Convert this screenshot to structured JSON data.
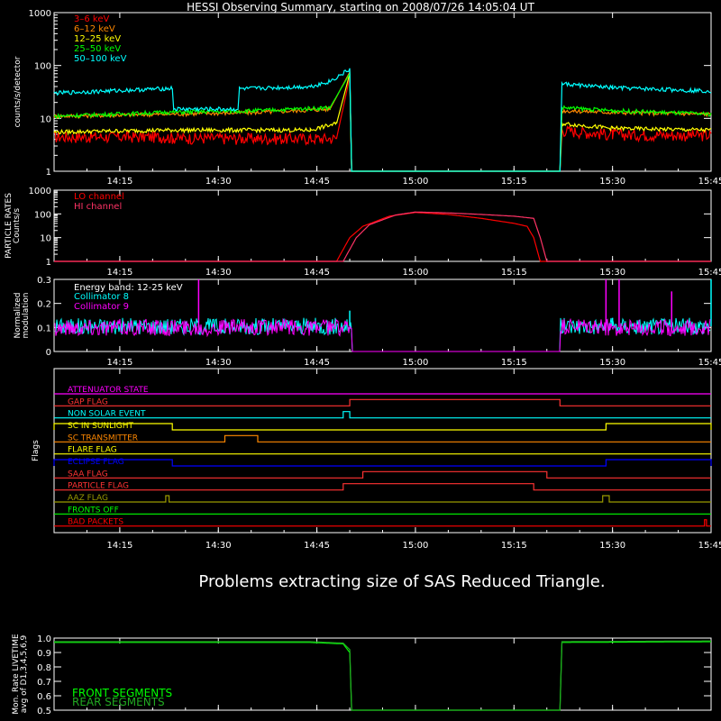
{
  "title": "HESSI Observing Summary, starting on 2008/07/26 14:05:04 UT",
  "message": "Problems extracting size of SAS Reduced Triangle.",
  "time_axis": {
    "start": "14:05",
    "end": "15:45",
    "tick_labels": [
      "14:15",
      "14:30",
      "14:45",
      "15:00",
      "15:15",
      "15:30",
      "15:45"
    ]
  },
  "chart_data": [
    {
      "type": "line",
      "name": "count_rates",
      "ylabel": "counts/s/detector",
      "yscale": "log",
      "ylim": [
        1,
        1000
      ],
      "ytick_labels": [
        "1",
        "10",
        "100",
        "1000"
      ],
      "legend_position": "top-left",
      "series": [
        {
          "name": "3–6 keV",
          "color": "#ff0000",
          "points": [
            [
              "14:05",
              4.5
            ],
            [
              "14:22",
              4.5
            ],
            [
              "14:23",
              4.3
            ],
            [
              "14:36",
              4.2
            ],
            [
              "14:44",
              4.2
            ],
            [
              "14:48",
              4.2
            ],
            [
              "14:50",
              60
            ],
            [
              "14:50.3",
              1
            ],
            [
              "15:22",
              1
            ],
            [
              "15:22.3",
              6
            ],
            [
              "15:30",
              5
            ],
            [
              "15:45",
              4.8
            ]
          ]
        },
        {
          "name": "6–12 keV",
          "color": "#ff8800",
          "points": [
            [
              "14:05",
              11
            ],
            [
              "14:22",
              12
            ],
            [
              "14:36",
              13
            ],
            [
              "14:47",
              15
            ],
            [
              "14:50",
              75
            ],
            [
              "14:50.3",
              1
            ],
            [
              "15:22",
              1
            ],
            [
              "15:22.3",
              14
            ],
            [
              "15:30",
              13
            ],
            [
              "15:45",
              12
            ]
          ]
        },
        {
          "name": "12–25 keV",
          "color": "#ffff00",
          "points": [
            [
              "14:05",
              5.5
            ],
            [
              "14:22",
              6
            ],
            [
              "14:36",
              6
            ],
            [
              "14:44",
              6
            ],
            [
              "14:48",
              8
            ],
            [
              "14:50",
              70
            ],
            [
              "14:50.3",
              1
            ],
            [
              "15:22",
              1
            ],
            [
              "15:22.3",
              8
            ],
            [
              "15:30",
              6.5
            ],
            [
              "15:45",
              6
            ]
          ]
        },
        {
          "name": "25–50 keV",
          "color": "#00ff00",
          "points": [
            [
              "14:05",
              11
            ],
            [
              "14:22",
              13
            ],
            [
              "14:36",
              14
            ],
            [
              "14:47",
              16
            ],
            [
              "14:50",
              70
            ],
            [
              "14:50.3",
              1
            ],
            [
              "15:22",
              1
            ],
            [
              "15:22.3",
              16
            ],
            [
              "15:30",
              14
            ],
            [
              "15:45",
              12
            ]
          ]
        },
        {
          "name": "50–100 keV",
          "color": "#00ffff",
          "points": [
            [
              "14:05",
              30
            ],
            [
              "14:23",
              37
            ],
            [
              "14:23.2",
              15
            ],
            [
              "14:33",
              15
            ],
            [
              "14:33.2",
              36
            ],
            [
              "14:44",
              40
            ],
            [
              "14:47",
              50
            ],
            [
              "14:50",
              85
            ],
            [
              "14:50.3",
              1
            ],
            [
              "15:22",
              1
            ],
            [
              "15:22.3",
              45
            ],
            [
              "15:30",
              38
            ],
            [
              "15:45",
              33
            ]
          ]
        }
      ]
    },
    {
      "type": "line",
      "name": "particle_rates",
      "ylabel": "PARTICLE RATES Counts/s",
      "yscale": "log",
      "ylim": [
        1,
        1000
      ],
      "ytick_labels": [
        "1",
        "10",
        "100",
        "1000"
      ],
      "legend_position": "top-left",
      "series": [
        {
          "name": "LO channel",
          "color": "#ff0000",
          "points": [
            [
              "14:05",
              1
            ],
            [
              "14:48",
              1
            ],
            [
              "14:50",
              10
            ],
            [
              "14:52",
              30
            ],
            [
              "14:56",
              80
            ],
            [
              "15:00",
              115
            ],
            [
              "15:05",
              95
            ],
            [
              "15:10",
              65
            ],
            [
              "15:15",
              40
            ],
            [
              "15:17",
              30
            ],
            [
              "15:18",
              10
            ],
            [
              "15:19",
              1
            ],
            [
              "15:45",
              1
            ]
          ]
        },
        {
          "name": "HI channel",
          "color": "#ff3366",
          "points": [
            [
              "14:05",
              1
            ],
            [
              "14:49",
              1
            ],
            [
              "14:51",
              10
            ],
            [
              "14:53",
              35
            ],
            [
              "14:57",
              90
            ],
            [
              "15:00",
              120
            ],
            [
              "15:05",
              110
            ],
            [
              "15:10",
              95
            ],
            [
              "15:15",
              80
            ],
            [
              "15:18",
              65
            ],
            [
              "15:19",
              10
            ],
            [
              "15:20",
              1
            ],
            [
              "15:45",
              1
            ]
          ]
        }
      ]
    },
    {
      "type": "line",
      "name": "modulation",
      "ylabel": "Normalized modulation",
      "ylim": [
        0,
        0.3
      ],
      "ytick_labels": [
        "0",
        "0.1",
        "0.2",
        "0.3"
      ],
      "annotation": "Energy band: 12-25 keV",
      "legend_position": "top-left",
      "series": [
        {
          "name": "Collimator 8",
          "color": "#00ffff",
          "mean": 0.105,
          "spikes": [
            [
              "14:50",
              0.17
            ],
            [
              "15:30",
              0.14
            ],
            [
              "15:45",
              0.3
            ]
          ]
        },
        {
          "name": "Collimator 9",
          "color": "#ff00ff",
          "mean": 0.1,
          "spikes": [
            [
              "14:27",
              0.3
            ],
            [
              "15:29",
              0.3
            ],
            [
              "15:31",
              0.3
            ],
            [
              "15:39",
              0.25
            ]
          ]
        }
      ],
      "data_gaps": [
        [
          "14:50.3",
          "15:22"
        ]
      ]
    },
    {
      "type": "line",
      "name": "flags",
      "ylabel": "Flags",
      "flags": [
        {
          "name": "ATTENUATOR STATE",
          "color": "#ff00ff",
          "intervals": []
        },
        {
          "name": "GAP FLAG",
          "color": "#ff3333",
          "intervals": [
            [
              "14:50",
              "15:22"
            ]
          ]
        },
        {
          "name": "NON SOLAR EVENT",
          "color": "#00ffff",
          "intervals": [
            [
              "14:49",
              "14:50"
            ]
          ]
        },
        {
          "name": "SC IN SUNLIGHT",
          "color": "#ffff00",
          "intervals": [
            [
              "14:05",
              "14:23"
            ],
            [
              "15:29",
              "15:45"
            ]
          ],
          "inverted": true
        },
        {
          "name": "SC TRANSMITTER",
          "color": "#ff8800",
          "intervals": [
            [
              "14:31",
              "14:36"
            ]
          ]
        },
        {
          "name": "FLARE FLAG",
          "color": "#ffff00",
          "intervals": []
        },
        {
          "name": "ECLIPSE FLAG",
          "color": "#0000ff",
          "intervals": [
            [
              "14:05",
              "14:23"
            ],
            [
              "15:29",
              "15:45"
            ]
          ]
        },
        {
          "name": "SAA FLAG",
          "color": "#ff3333",
          "intervals": [
            [
              "14:52",
              "15:20"
            ]
          ]
        },
        {
          "name": "PARTICLE FLAG",
          "color": "#ff3333",
          "intervals": [
            [
              "14:49",
              "15:18"
            ]
          ]
        },
        {
          "name": "AAZ FLAG",
          "color": "#999900",
          "intervals": [
            [
              "14:22",
              "14:22.5"
            ],
            [
              "15:28.5",
              "15:29.5"
            ]
          ]
        },
        {
          "name": "FRONTS OFF",
          "color": "#00ff00",
          "intervals": []
        },
        {
          "name": "BAD PACKETS",
          "color": "#ff0000",
          "intervals": [
            [
              "15:44",
              "15:44.3"
            ]
          ]
        }
      ]
    },
    {
      "type": "line",
      "name": "livetime",
      "ylabel": "Mon. Rate LIVETIME avg of D1,3,4,5,6,9",
      "ylim": [
        0.5,
        1.0
      ],
      "ytick_labels": [
        "0.5",
        "0.6",
        "0.7",
        "0.8",
        "0.9",
        "1.0"
      ],
      "legend_position": "bottom-left",
      "series": [
        {
          "name": "FRONT SEGMENTS",
          "color": "#00ff00",
          "points": [
            [
              "14:05",
              0.97
            ],
            [
              "14:44",
              0.97
            ],
            [
              "14:49",
              0.96
            ],
            [
              "14:50",
              0.9
            ],
            [
              "14:50.3",
              0.5
            ],
            [
              "15:22",
              0.5
            ],
            [
              "15:22.3",
              0.97
            ],
            [
              "15:45",
              0.975
            ]
          ]
        },
        {
          "name": "REAR SEGMENTS",
          "color": "#22aa22",
          "points": [
            [
              "14:05",
              0.975
            ],
            [
              "14:44",
              0.975
            ],
            [
              "14:49",
              0.965
            ],
            [
              "14:50",
              0.92
            ],
            [
              "14:50.3",
              0.5
            ],
            [
              "15:22",
              0.5
            ],
            [
              "15:22.3",
              0.975
            ],
            [
              "15:45",
              0.98
            ]
          ]
        }
      ]
    }
  ]
}
